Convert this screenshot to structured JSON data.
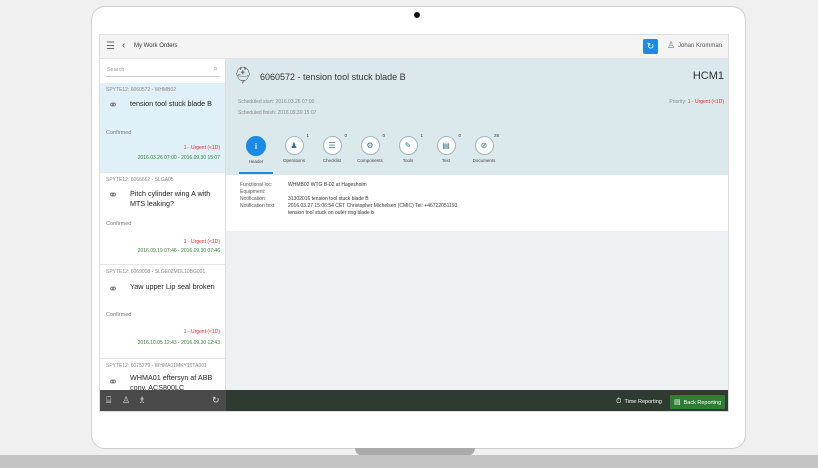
{
  "shell": {
    "title": "My Work Orders",
    "user": "Johan Kromman"
  },
  "list": {
    "search_placeholder": "Search",
    "items": [
      {
        "id": "SPYTE12: 6060572 - WHMB02",
        "title": "tension tool stuck blade B",
        "status": "Confirmed",
        "priority": "1 - Urgent (<1D)",
        "dates": "2016.03.26 07:00 - 2016.09.30 15:07"
      },
      {
        "id": "SPYTE12: 6066662 - SLGA05",
        "title": "Pitch cylinder wing A with MTS leaking?",
        "status": "Confirmed",
        "priority": "1 - Urgent (<1D)",
        "dates": "2016.09.19 07:46 - 2016.09.30 07:46"
      },
      {
        "id": "SPYTE12: 6069008 - SLGE02MDL10BG001",
        "title": "Yaw upper Lip seal broken",
        "status": "Confirmed",
        "priority": "1 - Urgent (<1D)",
        "dates": "2016.10.05 12:43 - 2016.09.30 12:43"
      },
      {
        "id": "SPYTE12: 6075279 - WHMA01MKY10TA001",
        "title": "WHMA01 eftersyn af ABB conv. ACS800LC"
      }
    ]
  },
  "detail": {
    "title": "6060572 - tension tool stuck blade B",
    "plant": "HCM1",
    "scheduled_start": "Scheduled start: 2016.03.26 07:00",
    "scheduled_finish": "Scheduled finish: 2016.09.30 15:07",
    "priority_label": "Priority:",
    "priority_value": "1 - Urgent (<1D)",
    "tabs": [
      {
        "label": "Header",
        "count": "",
        "glyph": "i"
      },
      {
        "label": "Operations",
        "count": "1",
        "glyph": "♟"
      },
      {
        "label": "Checklist",
        "count": "0",
        "glyph": "☰"
      },
      {
        "label": "Components",
        "count": "0",
        "glyph": "⚙"
      },
      {
        "label": "Tools",
        "count": "1",
        "glyph": "✎"
      },
      {
        "label": "Text",
        "count": "0",
        "glyph": "▤"
      },
      {
        "label": "Documents",
        "count": "28",
        "glyph": "⊘"
      }
    ],
    "fields": {
      "functional_loc_label": "Functional loc:",
      "functional_loc_value": "WHMB02 WTG B-02 at Hagesholm",
      "equipment_label": "Equipment:",
      "equipment_value": "",
      "notification_label": "Notification:",
      "notification_value": "31302016 tension tool stuck blade B",
      "notification_text_label": "Notification text:",
      "notification_text_value": "2016.03.27 15:06:54 CET Christopher Michelsen (CMIC) Tel: +46722051193",
      "notification_text_value_2": "tension tool stuck on outer ring blade b"
    }
  },
  "footer": {
    "time_reporting": "Time Reporting",
    "back_reporting": "Back Reporting"
  }
}
